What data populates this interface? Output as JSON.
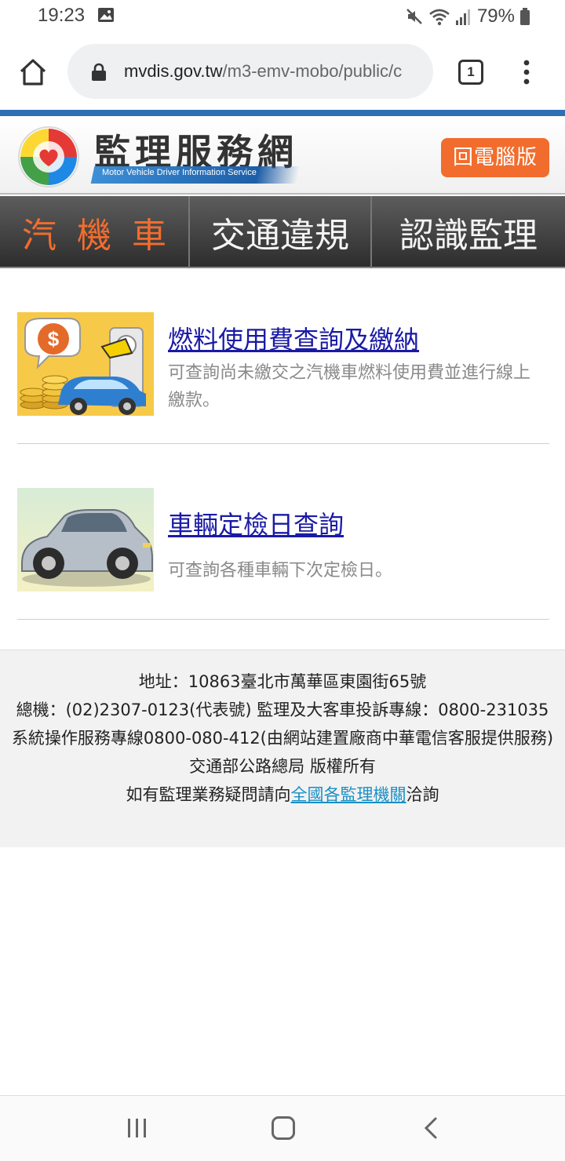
{
  "status_bar": {
    "time": "19:23",
    "battery": "79%",
    "icons": [
      "image-icon",
      "mute-icon",
      "wifi-icon",
      "signal-icon",
      "battery-icon"
    ]
  },
  "browser": {
    "url_domain": "mvdis.gov.tw",
    "url_path": "/m3-emv-mobo/public/c",
    "tab_count": "1"
  },
  "site_header": {
    "title": "監理服務網",
    "subtitle": "Motor Vehicle Driver Information Service",
    "desktop_button": "回電腦版"
  },
  "nav": {
    "items": [
      "汽機車",
      "交通違規",
      "認識監理"
    ],
    "active_color": "#f26d2d"
  },
  "services": [
    {
      "title": "燃料使用費查詢及繳納",
      "description": "可查詢尚未繳交之汽機車燃料使用費並進行線上繳款。"
    },
    {
      "title": "車輛定檢日查詢",
      "description": "可查詢各種車輛下次定檢日。"
    }
  ],
  "footer": {
    "address": "地址：10863臺北市萬華區東園街65號",
    "phone": "總機：(02)2307-0123(代表號) 監理及大客車投訴專線：0800-231035",
    "support": "系統操作服務專線0800-080-412(由網站建置廠商中華電信客服提供服務)",
    "copyright": "交通部公路總局 版權所有",
    "contact_prefix": "如有監理業務疑問請向",
    "contact_link": "全國各監理機關",
    "contact_suffix": "洽詢"
  },
  "colors": {
    "accent_blue": "#2f6fb3",
    "orange": "#f26d2d",
    "link": "#1a1aa6",
    "footer_link": "#1a8fc4"
  }
}
